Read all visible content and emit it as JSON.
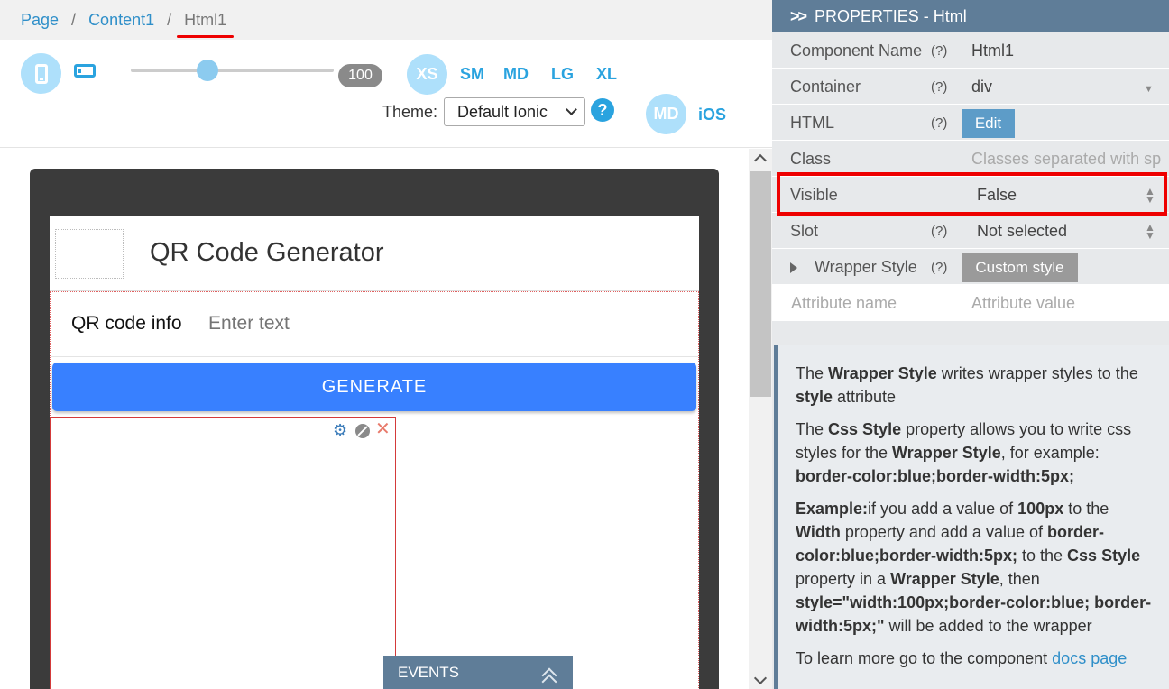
{
  "breadcrumb": {
    "items": [
      "Page",
      "Content1"
    ],
    "separator": "/",
    "current": "Html1"
  },
  "toolbar": {
    "slider_value": "100",
    "breakpoints": {
      "xs": "XS",
      "sm": "SM",
      "md": "MD",
      "lg": "LG",
      "xl": "XL"
    },
    "theme_label": "Theme:",
    "theme_value": "Default Ionic",
    "help": "?",
    "platform_md": "MD",
    "platform_ios": "iOS"
  },
  "device": {
    "app_title": "QR Code Generator",
    "qr_label": "QR code info",
    "qr_placeholder": "Enter text",
    "generate_label": "GENERATE"
  },
  "events_tab": {
    "label": "EVENTS"
  },
  "properties": {
    "header": "PROPERTIES - Html",
    "rows": [
      {
        "label": "Component Name",
        "help": "(?)",
        "value": "Html1"
      },
      {
        "label": "Container",
        "help": "(?)",
        "value": "div"
      },
      {
        "label": "HTML",
        "help": "(?)",
        "value": "Edit"
      },
      {
        "label": "Class",
        "help": "",
        "value": "Classes separated with sp"
      },
      {
        "label": "Visible",
        "help": "",
        "value": "False"
      },
      {
        "label": "Slot",
        "help": "(?)",
        "value": "Not selected"
      },
      {
        "label": "Wrapper Style",
        "help": "(?)",
        "value": "Custom style"
      }
    ],
    "attr_name_placeholder": "Attribute name",
    "attr_value_placeholder": "Attribute value"
  },
  "info": {
    "p1_a": "The ",
    "p1_b": "Wrapper Style",
    "p1_c": " writes wrapper styles to the ",
    "p1_d": "style",
    "p1_e": " attribute",
    "p2_a": "The ",
    "p2_b": "Css Style",
    "p2_c": " property allows you to write css styles for the ",
    "p2_d": "Wrapper Style",
    "p2_e": ", for example: ",
    "p2_f": "border-color:blue;border-width:5px;",
    "p3_a": "Example:",
    "p3_b": "if you add a value of ",
    "p3_c": "100px",
    "p3_d": " to the ",
    "p3_e": "Width",
    "p3_f": " property and add a value of ",
    "p3_g": "border-color:blue;border-width:5px;",
    "p3_h": " to the ",
    "p3_i": "Css Style",
    "p3_j": " property in a ",
    "p3_k": "Wrapper Style",
    "p3_l": ", then ",
    "p3_m": "style=\"width:100px;border-color:blue; border-width:5px;\"",
    "p3_n": " will be added to the wrapper",
    "p4_a": "To learn more go to the component ",
    "p4_link": "docs page"
  },
  "colors": {
    "accent": "#2aa3df",
    "panel_header": "#5f7d98",
    "generate_button": "#3880ff",
    "highlight": "#e00000"
  }
}
